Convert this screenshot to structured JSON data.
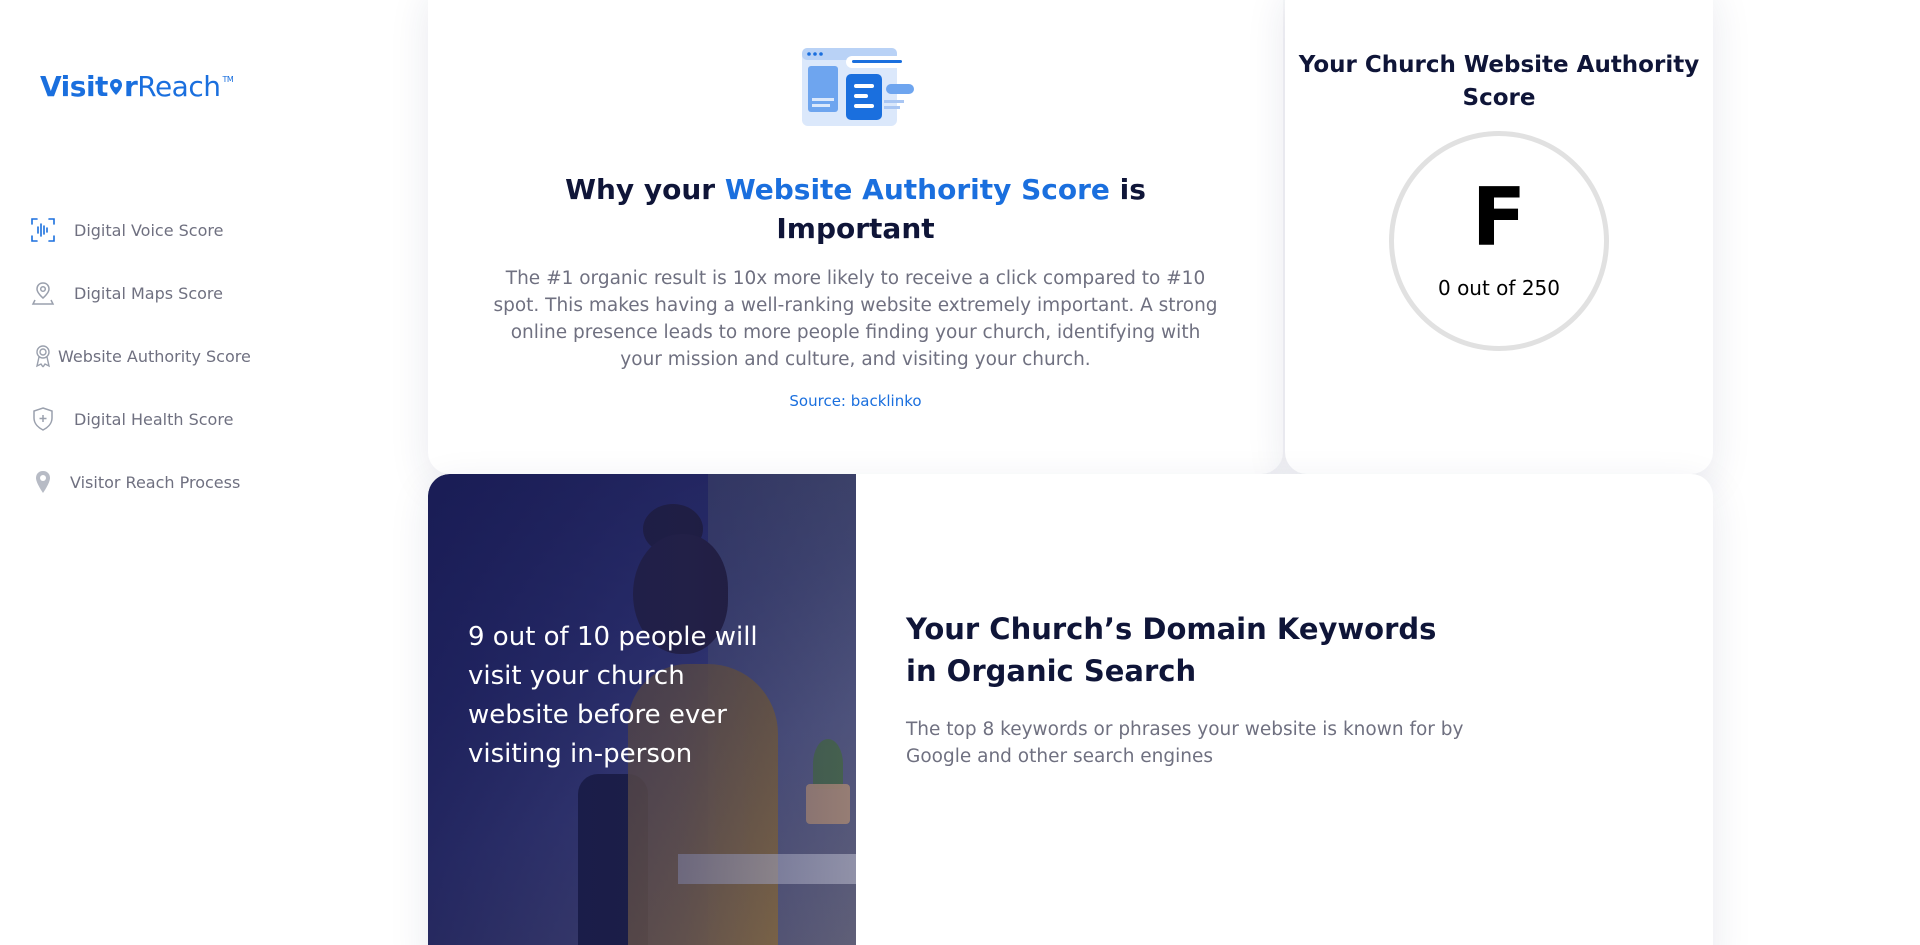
{
  "brand": {
    "logo_part1": "Visit",
    "logo_part2": "r",
    "logo_part3": "Reach",
    "tm": "TM",
    "color": "#1a6fde"
  },
  "sidebar": {
    "items": [
      {
        "label": "Digital Voice Score",
        "icon": "voice-wave-icon"
      },
      {
        "label": "Digital Maps Score",
        "icon": "map-pin-icon"
      },
      {
        "label": "Website Authority Score",
        "icon": "authority-badge-icon"
      },
      {
        "label": "Digital Health Score",
        "icon": "shield-health-icon"
      },
      {
        "label": "Visitor Reach Process",
        "icon": "location-pin-icon"
      }
    ]
  },
  "why": {
    "title_prefix": "Why your ",
    "title_highlight": "Website Authority Score",
    "title_suffix": " is Important",
    "body": "The #1 organic result is 10x more likely to receive a click compared to #10 spot. This makes having a well-ranking website extremely important. A strong online presence leads to more people finding your church, identifying with your mission and culture, and visiting your church.",
    "source": "Source: backlinko"
  },
  "score": {
    "title": "Your Church Website Authority Score",
    "grade": "F",
    "points": "0 out of 250"
  },
  "keywords": {
    "photo_text": "9 out of 10 people will visit your church website before ever visiting in-person",
    "title": "Your Church’s Domain Keywords in Organic Search",
    "subtitle": "The top 8 keywords or phrases your website is known for by Google and other search engines"
  },
  "colors": {
    "accent": "#1a6fde",
    "heading": "#0f1538",
    "muted": "#6f7080",
    "ring": "#e1e1e1"
  }
}
